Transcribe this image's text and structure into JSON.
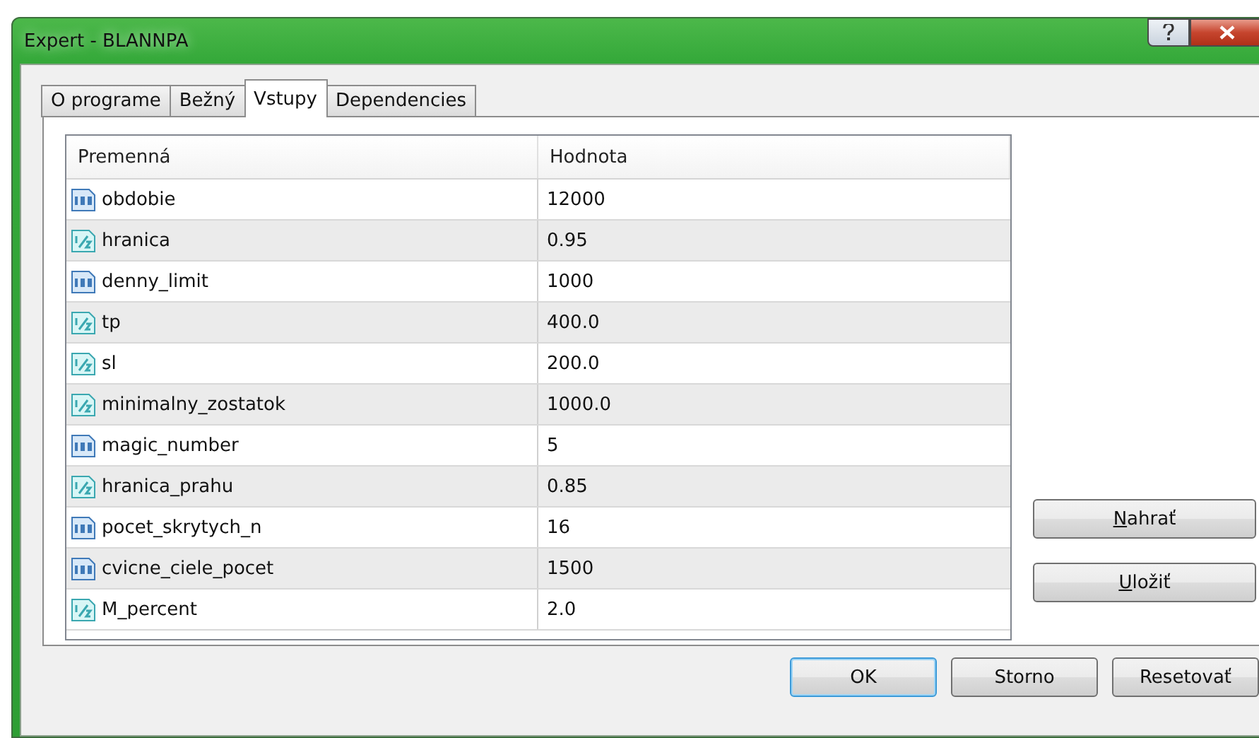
{
  "window": {
    "title": "Expert - BLANNPA"
  },
  "tabs": [
    {
      "label": "O programe",
      "selected": false
    },
    {
      "label": "Bežný",
      "selected": false
    },
    {
      "label": "Vstupy",
      "selected": true
    },
    {
      "label": "Dependencies",
      "selected": false
    }
  ],
  "table": {
    "columns": [
      "Premenná",
      "Hodnota"
    ],
    "rows": [
      {
        "kind": "int",
        "name": "obdobie",
        "value": "12000"
      },
      {
        "kind": "double",
        "name": "hranica",
        "value": "0.95"
      },
      {
        "kind": "int",
        "name": "denny_limit",
        "value": "1000"
      },
      {
        "kind": "double",
        "name": "tp",
        "value": "400.0"
      },
      {
        "kind": "double",
        "name": "sl",
        "value": "200.0"
      },
      {
        "kind": "double",
        "name": "minimalny_zostatok",
        "value": "1000.0"
      },
      {
        "kind": "int",
        "name": "magic_number",
        "value": "5"
      },
      {
        "kind": "double",
        "name": "hranica_prahu",
        "value": "0.85"
      },
      {
        "kind": "int",
        "name": "pocet_skrytych_n",
        "value": "16"
      },
      {
        "kind": "int",
        "name": "cvicne_ciele_pocet",
        "value": "1500"
      },
      {
        "kind": "double",
        "name": "M_percent",
        "value": "2.0"
      }
    ]
  },
  "side_buttons": [
    {
      "label": "Nahrať",
      "access_key_underlined": true
    },
    {
      "label": "Uložiť",
      "access_key_underlined": true
    }
  ],
  "footer_buttons": [
    {
      "label": "OK",
      "default": true
    },
    {
      "label": "Storno",
      "default": false
    },
    {
      "label": "Resetovať",
      "default": false
    }
  ]
}
